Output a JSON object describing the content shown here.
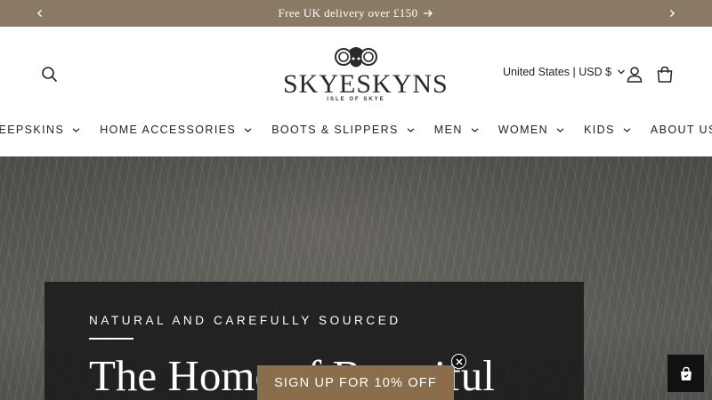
{
  "announcement": {
    "text": "Free UK delivery over £150",
    "prev_icon": "chevron-left-icon",
    "next_icon": "chevron-right-icon",
    "bg_color": "#8a7a63"
  },
  "header": {
    "logo_text": "SKYESKYNS",
    "logo_subtext": "ISLE OF SKYE",
    "locale": "United States | USD $"
  },
  "nav": {
    "items": [
      {
        "label": "SHEEPSKINS"
      },
      {
        "label": "HOME ACCESSORIES"
      },
      {
        "label": "BOOTS & SLIPPERS"
      },
      {
        "label": "MEN"
      },
      {
        "label": "WOMEN"
      },
      {
        "label": "KIDS"
      },
      {
        "label": "ABOUT US"
      }
    ]
  },
  "hero": {
    "eyebrow": "NATURAL AND CAREFULLY SOURCED",
    "title": "The Home of Beautiful"
  },
  "popup": {
    "signup_label": "SIGN UP FOR 10% OFF",
    "accent_color": "#8a6e4b"
  }
}
